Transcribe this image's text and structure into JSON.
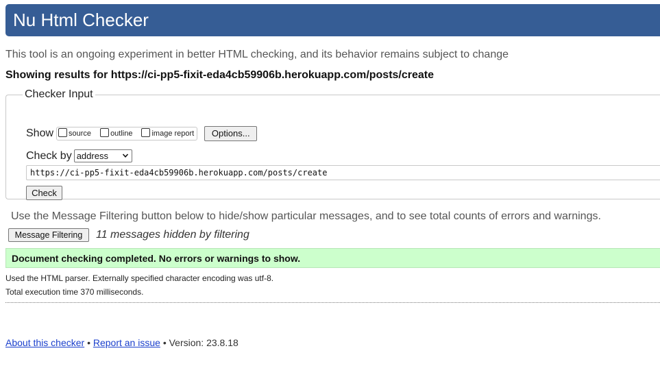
{
  "header": {
    "title": "Nu Html Checker"
  },
  "subtitle": "This tool is an ongoing experiment in better HTML checking, and its behavior remains subject to change",
  "showing_results": "Showing results for https://ci-pp5-fixit-eda4cb59906b.herokuapp.com/posts/create",
  "checker_input": {
    "legend": "Checker Input",
    "show_label": "Show",
    "show_options": [
      {
        "label": "source",
        "checked": false
      },
      {
        "label": "outline",
        "checked": false
      },
      {
        "label": "image report",
        "checked": false
      }
    ],
    "options_button": "Options...",
    "check_by_label": "Check by",
    "check_by_value": "address",
    "url_value": "https://ci-pp5-fixit-eda4cb59906b.herokuapp.com/posts/create",
    "check_button": "Check"
  },
  "filtering": {
    "note": "Use the Message Filtering button below to hide/show particular messages, and to see total counts of errors and warnings.",
    "button": "Message Filtering",
    "hidden_count": "11 messages hidden by filtering"
  },
  "result": {
    "success_message": "Document checking completed. No errors or warnings to show.",
    "success_color": "#ccffcc",
    "parser_info": "Used the HTML parser. Externally specified character encoding was utf-8.",
    "execution_time": "Total execution time 370 milliseconds."
  },
  "footer": {
    "about_link": "About this checker",
    "separator": "•",
    "report_link": "Report an issue",
    "version": "Version: 23.8.18"
  },
  "colors": {
    "header_bg": "#365d95",
    "link": "#1a3fcc"
  }
}
